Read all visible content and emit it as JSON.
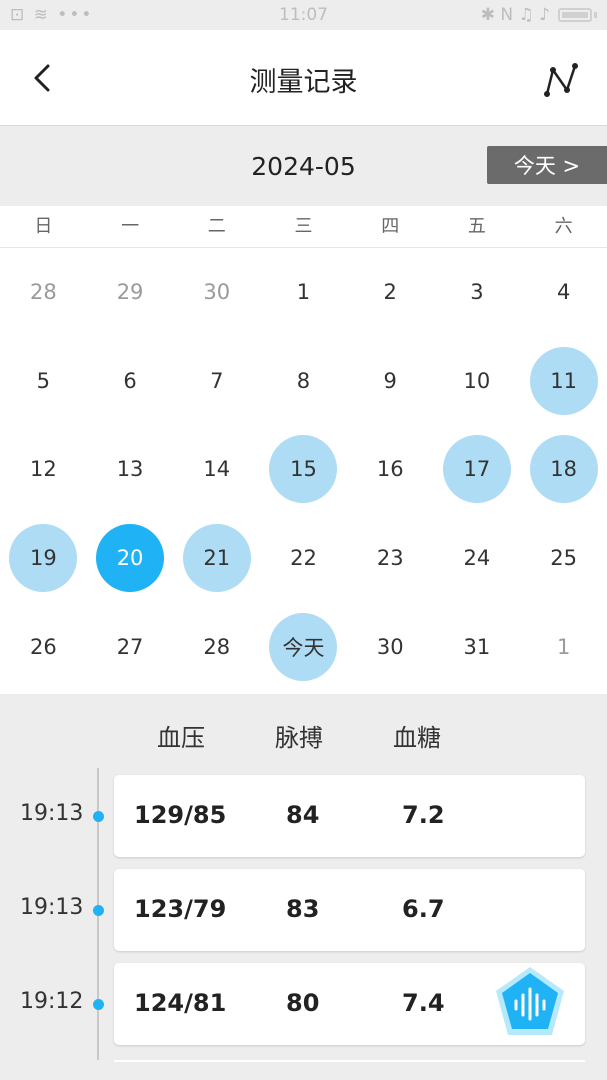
{
  "status_bar": {
    "left_icons": "⊡ ≋ •••",
    "time": "11:07",
    "right_icons": "✱ N ♫ ♪"
  },
  "header": {
    "title": "测量记录"
  },
  "month_bar": {
    "month": "2024-05",
    "today_button": "今天 >"
  },
  "weekdays": [
    "日",
    "一",
    "二",
    "三",
    "四",
    "五",
    "六"
  ],
  "calendar": [
    [
      "28",
      "29",
      "30",
      "1",
      "2",
      "3",
      "4"
    ],
    [
      "5",
      "6",
      "7",
      "8",
      "9",
      "10",
      "11"
    ],
    [
      "12",
      "13",
      "14",
      "15",
      "16",
      "17",
      "18"
    ],
    [
      "19",
      "20",
      "21",
      "22",
      "23",
      "24",
      "25"
    ],
    [
      "26",
      "27",
      "28",
      "今天",
      "30",
      "31",
      "1"
    ]
  ],
  "table_headers": {
    "bp": "血压",
    "pulse": "脉搏",
    "glucose": "血糖"
  },
  "records": [
    {
      "time": "19:13",
      "bp": "129/85",
      "pulse": "84",
      "glucose": "7.2"
    },
    {
      "time": "19:13",
      "bp": "123/79",
      "pulse": "83",
      "glucose": "6.7"
    },
    {
      "time": "19:12",
      "bp": "124/81",
      "pulse": "80",
      "glucose": "7.4"
    }
  ],
  "colors": {
    "accent": "#1fb3f5",
    "marked": "#aedcf5",
    "today_button_bg": "#6b6b6b"
  }
}
